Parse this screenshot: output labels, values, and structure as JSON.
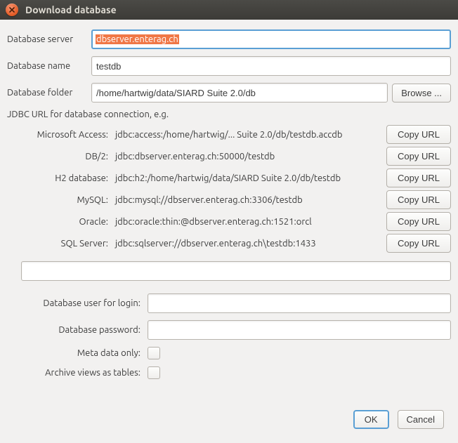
{
  "title": "Download database",
  "fields": {
    "server_label": "Database server",
    "server_value": "dbserver.enterag.ch",
    "name_label": "Database name",
    "name_value": "testdb",
    "folder_label": "Database folder",
    "folder_value": "/home/hartwig/data/SIARD Suite 2.0/db",
    "browse_label": "Browse ..."
  },
  "jdbc": {
    "header": "JDBC URL for database connection, e.g.",
    "copy_label": "Copy URL",
    "entries": [
      {
        "label": "Microsoft Access:",
        "url": "jdbc:access:/home/hartwig/... Suite 2.0/db/testdb.accdb"
      },
      {
        "label": "DB/2:",
        "url": "jdbc:dbserver.enterag.ch:50000/testdb"
      },
      {
        "label": "H2 database:",
        "url": "jdbc:h2:/home/hartwig/data/SIARD Suite 2.0/db/testdb"
      },
      {
        "label": "MySQL:",
        "url": "jdbc:mysql://dbserver.enterag.ch:3306/testdb"
      },
      {
        "label": "Oracle:",
        "url": "jdbc:oracle:thin:@dbserver.enterag.ch:1521:orcl"
      },
      {
        "label": "SQL Server:",
        "url": "jdbc:sqlserver://dbserver.enterag.ch\\testdb:1433"
      }
    ]
  },
  "login": {
    "user_label": "Database user for login:",
    "user_value": "",
    "password_label": "Database password:",
    "password_value": "",
    "meta_label": "Meta data only:",
    "views_label": "Archive views as tables:"
  },
  "buttons": {
    "ok": "OK",
    "cancel": "Cancel"
  }
}
